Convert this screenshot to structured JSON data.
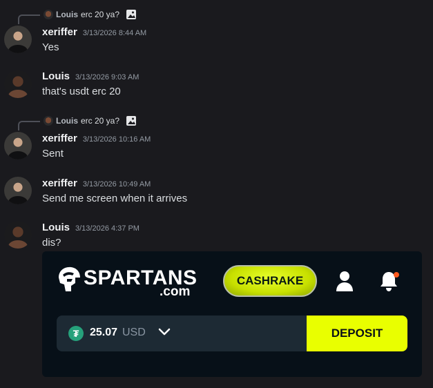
{
  "messages": [
    {
      "reply_to": {
        "name": "Louis",
        "text": "erc 20 ya?",
        "attachment_icon": "image-icon"
      },
      "author": "xeriffer",
      "timestamp": "3/13/2026 8:44 AM",
      "text": "Yes"
    },
    {
      "author": "Louis",
      "timestamp": "3/13/2026 9:03 AM",
      "text": "that's usdt erc 20"
    },
    {
      "reply_to": {
        "name": "Louis",
        "text": "erc 20 ya?",
        "attachment_icon": "image-icon"
      },
      "author": "xeriffer",
      "timestamp": "3/13/2026 10:16 AM",
      "text": "Sent"
    },
    {
      "author": "xeriffer",
      "timestamp": "3/13/2026 10:49 AM",
      "text": "Send me screen when it arrives"
    },
    {
      "author": "Louis",
      "timestamp": "3/13/2026 4:37 PM",
      "text": "dis?"
    }
  ],
  "embed": {
    "brand": "SPARTANS",
    "brand_suffix": ".com",
    "cashrake_label": "CASHRAKE",
    "balance_amount": "25.07",
    "balance_currency": "USD",
    "currency_symbol": "₮",
    "deposit_label": "DEPOSIT",
    "icons": [
      "spartan-helmet-icon",
      "user-icon",
      "bell-icon",
      "tether-icon",
      "chevron-down-icon"
    ],
    "colors": {
      "accent": "#e9ff00",
      "background": "#071018",
      "notification_dot": "#ff5a1f",
      "tether": "#26a17b"
    }
  }
}
